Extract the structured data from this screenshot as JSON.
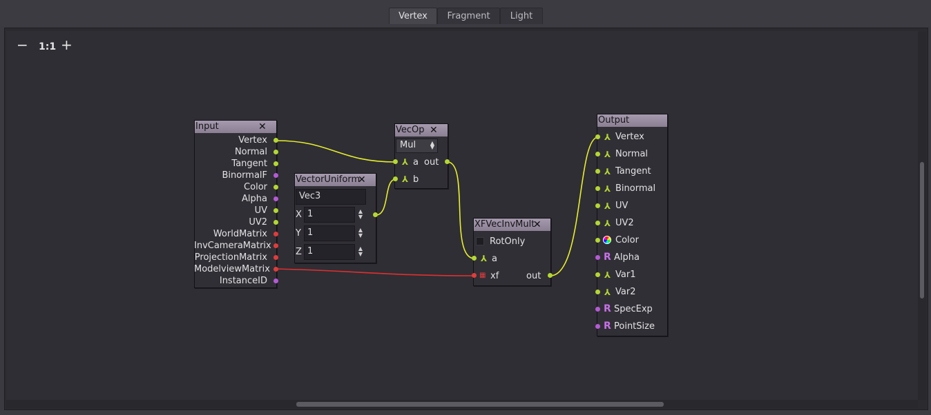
{
  "tabs": [
    "Vertex",
    "Fragment",
    "Light"
  ],
  "active_tab": "Vertex",
  "zoom": {
    "minus": "−",
    "reset": "1:1",
    "plus": "+"
  },
  "nodes": {
    "input": {
      "title": "Input",
      "ports": [
        "Vertex",
        "Normal",
        "Tangent",
        "BinormalF",
        "Color",
        "Alpha",
        "UV",
        "UV2",
        "WorldMatrix",
        "InvCameraMatrix",
        "ProjectionMatrix",
        "ModelviewMatrix",
        "InstanceID"
      ]
    },
    "vector_uniform": {
      "title": "VectorUniform",
      "name_value": "Vec3",
      "x_label": "X",
      "x_value": "1",
      "y_label": "Y",
      "y_value": "1",
      "z_label": "Z",
      "z_value": "1"
    },
    "vecop": {
      "title": "VecOp",
      "operation": "Mul",
      "in_a": "a",
      "in_b": "b",
      "out": "out"
    },
    "xfvecinvmult": {
      "title": "XFVecInvMult",
      "rotonly_label": "RotOnly",
      "rotonly_checked": false,
      "in_a": "a",
      "in_xf": "xf",
      "out": "out"
    },
    "output": {
      "title": "Output",
      "ports": [
        "Vertex",
        "Normal",
        "Tangent",
        "Binormal",
        "UV",
        "UV2",
        "Color",
        "Alpha",
        "Var1",
        "Var2",
        "SpecExp",
        "PointSize"
      ]
    }
  },
  "colors": {
    "vector_port": "#b4d830",
    "scalar_port": "#b55ad6",
    "matrix_port": "#e03c3c",
    "wire_vector": "#e8f02a",
    "wire_matrix": "#e03030"
  }
}
